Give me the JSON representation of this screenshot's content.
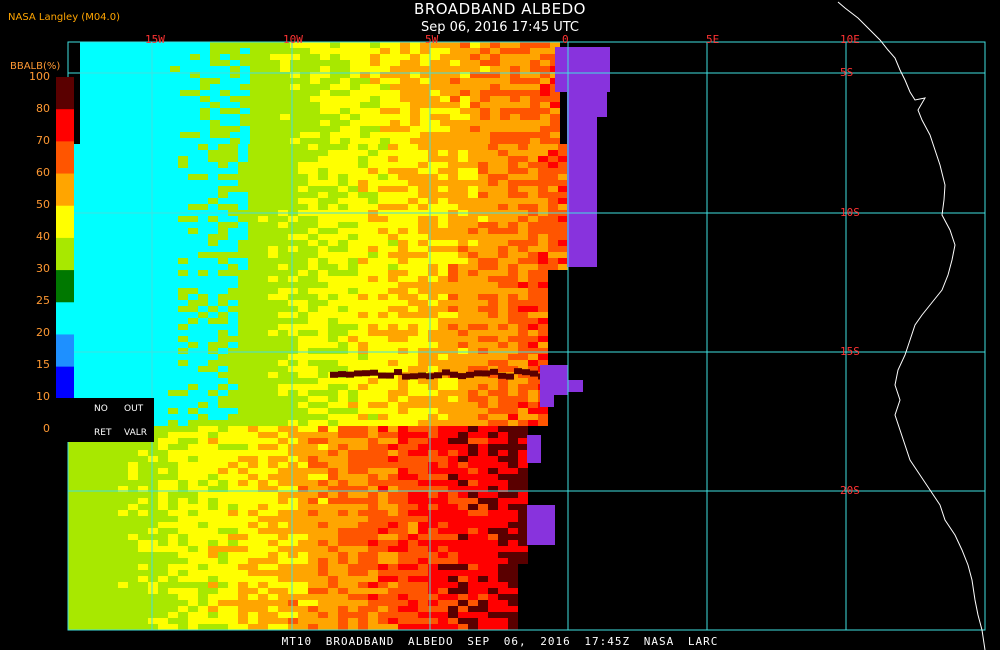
{
  "header": {
    "title": "BROADBAND ALBEDO",
    "subtitle": "Sep 06, 2016 17:45 UTC",
    "agency": "NASA Langley (M04.0)"
  },
  "colorbar": {
    "title": "BBALB(%)",
    "ticks": [
      "100",
      "80",
      "70",
      "60",
      "50",
      "40",
      "30",
      "25",
      "20",
      "15",
      "10",
      "0"
    ],
    "colors": [
      "#5a0000",
      "#ff0000",
      "#ff5500",
      "#ffa500",
      "#ffff00",
      "#a8e800",
      "#007800",
      "#00ffff",
      "#1e90ff",
      "#0000ff",
      "#8833dd"
    ],
    "legend": {
      "no": "NO",
      "out": "OUT",
      "ret": "RET",
      "valr": "VALR"
    }
  },
  "grid": {
    "lon_labels": [
      "15W",
      "10W",
      "5W",
      "0",
      "5E",
      "10E"
    ],
    "lat_labels": [
      "5S",
      "10S",
      "15S",
      "20S"
    ],
    "grid_color": "#40e0e0",
    "label_color": "#ff3333"
  },
  "footer": {
    "text": "MT10  BROADBAND ALBEDO  SEP 06, 2016 17:45Z  NASA LARC"
  }
}
